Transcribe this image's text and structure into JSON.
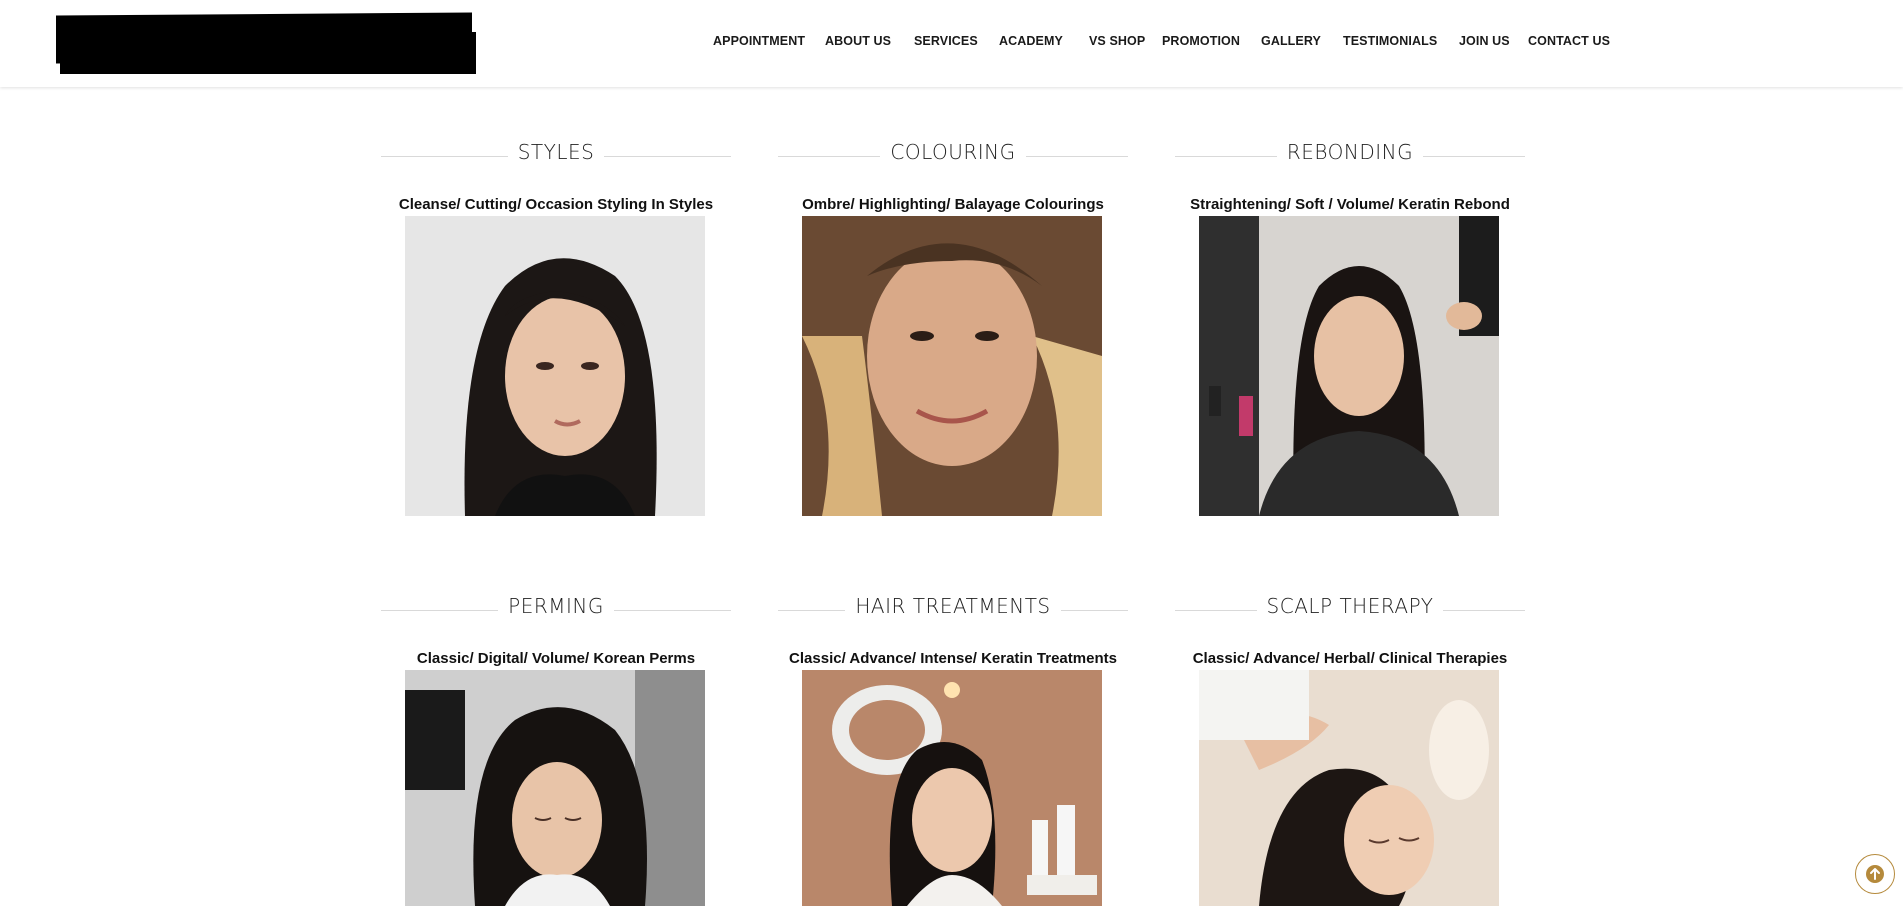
{
  "nav": {
    "items": [
      {
        "label": "APPOINTMENT"
      },
      {
        "label": "ABOUT US"
      },
      {
        "label": "SERVICES"
      },
      {
        "label": "ACADEMY"
      },
      {
        "label": "VS SHOP"
      },
      {
        "label": "PROMOTION"
      },
      {
        "label": "GALLERY"
      },
      {
        "label": "TESTIMONIALS"
      },
      {
        "label": "JOIN US"
      },
      {
        "label": "CONTACT US"
      }
    ]
  },
  "services": [
    {
      "title": "STYLES",
      "subtitle": "Cleanse/ Cutting/ Occasion Styling In Styles"
    },
    {
      "title": "COLOURING",
      "subtitle": "Ombre/ Highlighting/ Balayage Colourings"
    },
    {
      "title": "REBONDING",
      "subtitle": "Straightening/ Soft / Volume/ Keratin Rebond"
    },
    {
      "title": "PERMING",
      "subtitle": "Classic/ Digital/ Volume/ Korean Perms"
    },
    {
      "title": "HAIR TREATMENTS",
      "subtitle": "Classic/ Advance/ Intense/ Keratin Treatments"
    },
    {
      "title": "SCALP THERAPY",
      "subtitle": "Classic/ Advance/ Herbal/ Clinical Therapies"
    }
  ],
  "colors": {
    "accent": "#b58a3c",
    "text": "#111111",
    "divider": "#d9d9d9"
  },
  "icons": {
    "scroll_top": "arrow-up-circle-icon"
  }
}
